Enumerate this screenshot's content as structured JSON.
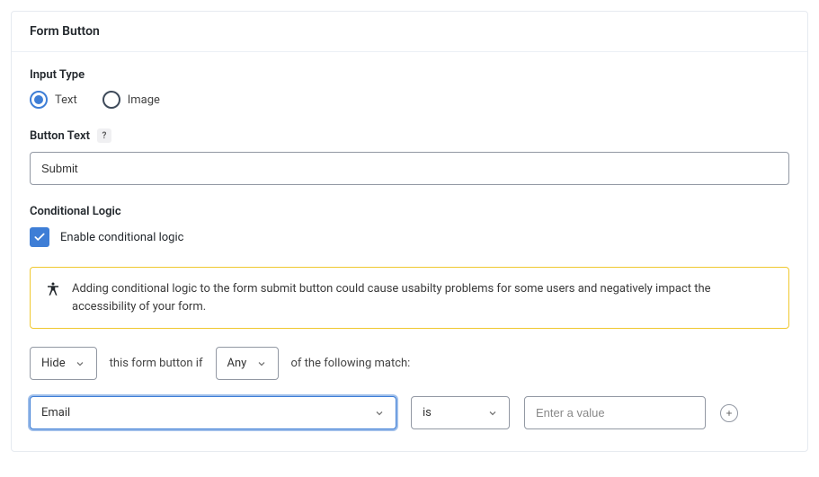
{
  "header": {
    "title": "Form Button"
  },
  "inputType": {
    "label": "Input Type",
    "options": {
      "text": "Text",
      "image": "Image"
    },
    "selected": "text"
  },
  "buttonText": {
    "label": "Button Text",
    "value": "Submit",
    "help": "?"
  },
  "conditionalLogic": {
    "label": "Conditional Logic",
    "checkboxLabel": "Enable conditional logic",
    "enabled": true,
    "warning": "Adding conditional logic to the form submit button could cause usabilty problems for some users and negatively impact the accessibility of your form.",
    "action": "Hide",
    "midText1": "this form button if",
    "match": "Any",
    "midText2": "of the following match:",
    "rule": {
      "field": "Email",
      "operator": "is",
      "valuePlaceholder": "Enter a value"
    }
  }
}
